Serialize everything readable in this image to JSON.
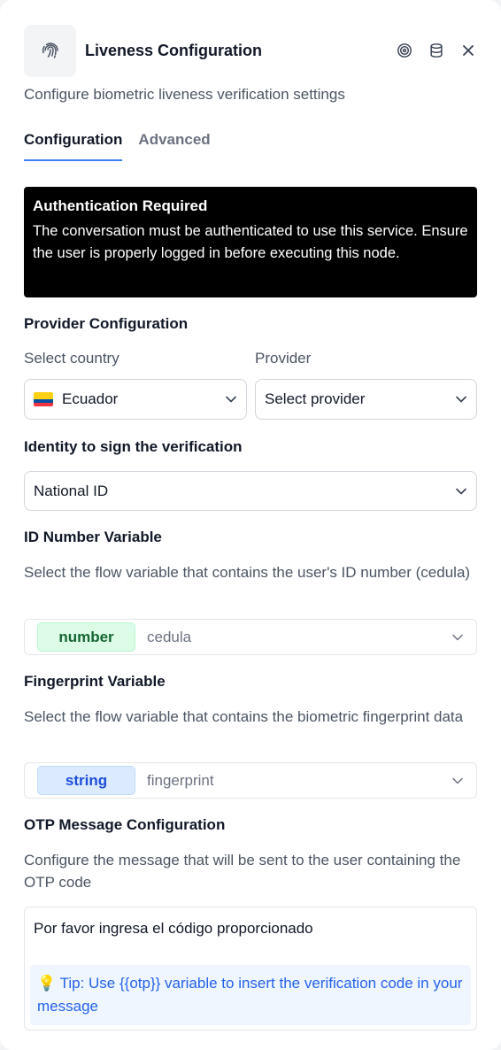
{
  "header": {
    "title": "Liveness Configuration",
    "subtitle": "Configure biometric liveness verification settings",
    "icons": [
      "fingerprint-icon",
      "target-icon",
      "database-icon",
      "close-icon"
    ]
  },
  "tabs": [
    {
      "label": "Configuration",
      "active": true
    },
    {
      "label": "Advanced",
      "active": false
    }
  ],
  "alert": {
    "title": "Authentication Required",
    "body": "The conversation must be authenticated to use this service. Ensure the user is properly logged in before executing this node."
  },
  "provider_config": {
    "section_title": "Provider Configuration",
    "country_label": "Select country",
    "country_value": "Ecuador",
    "provider_label": "Provider",
    "provider_placeholder": "Select provider"
  },
  "identity": {
    "label": "Identity to sign the verification",
    "value": "National ID"
  },
  "id_variable": {
    "label": "ID Number Variable",
    "help": "Select the flow variable that contains the user's ID number (cedula)",
    "type_badge": "number",
    "value": "cedula"
  },
  "fingerprint_variable": {
    "label": "Fingerprint Variable",
    "help": "Select the flow variable that contains the biometric fingerprint data",
    "type_badge": "string",
    "value": "fingerprint"
  },
  "otp": {
    "label": "OTP Message Configuration",
    "help": "Configure the message that will be sent to the user containing the OTP code",
    "message": "Por favor ingresa el código proporcionado",
    "tip": "💡 Tip: Use {{otp}} variable to insert the verification code in your message"
  },
  "colors": {
    "accent": "#3b82f6",
    "number_badge_bg": "#dcfce7",
    "string_badge_bg": "#dbeafe",
    "alert_bg": "#000000"
  }
}
